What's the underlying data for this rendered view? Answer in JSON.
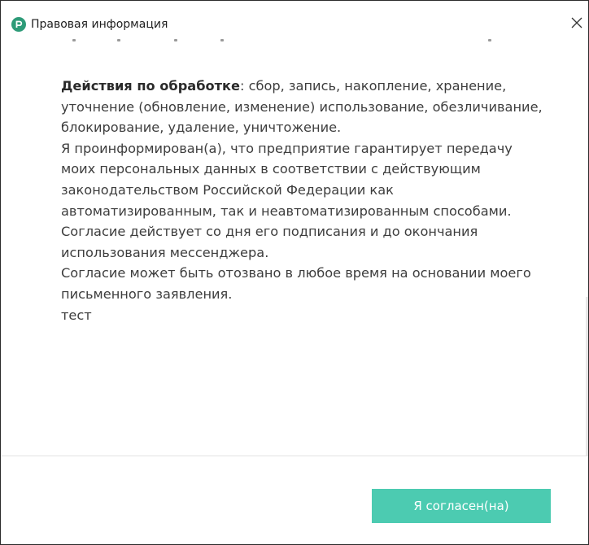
{
  "window": {
    "title": "Правовая информация",
    "icon": "app-logo-icon",
    "close_icon": "close-icon"
  },
  "content": {
    "actions_label": "Действия по обработке",
    "actions_text": ": сбор, запись, накопление, хранение, уточнение (обновление, изменение) использование, обезличивание, блокирование, удаление, уничтожение.",
    "paragraph_1": "Я проинформирован(а), что предприятие гарантирует передачу моих персональных данных в соответствии с действующим законодательством Российской Федерации как автоматизированным, так и неавтоматизированным способами.",
    "paragraph_2": "Согласие действует со дня его подписания и до окончания использования мессенджера.",
    "paragraph_3": "Согласие может быть отозвано в любое время на основании моего письменного заявления.",
    "paragraph_4": "тест"
  },
  "footer": {
    "agree_label": "Я согласен(на)"
  },
  "colors": {
    "accent": "#4ccbb1",
    "logo": "#2d9b78"
  }
}
